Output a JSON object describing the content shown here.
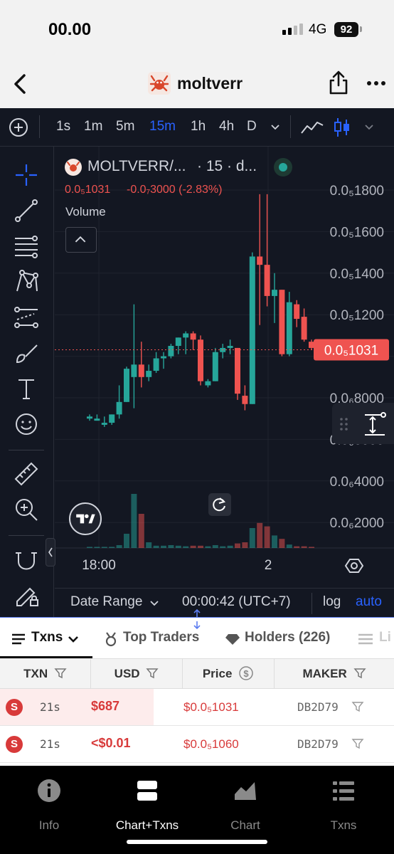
{
  "status": {
    "time": "00.00",
    "network": "4G",
    "battery": "92"
  },
  "nav": {
    "title": "moltverr"
  },
  "toolbar": {
    "timeframes": [
      "1s",
      "1m",
      "5m",
      "15m",
      "1h",
      "4h",
      "D"
    ],
    "active_timeframe": "15m"
  },
  "legend": {
    "symbol": "MOLTVERR/...",
    "interval": "· 15 · d...",
    "price": "0.0₅1031",
    "change": "-0.0₇3000 (-2.83%)",
    "volume_label": "Volume"
  },
  "chart_data": {
    "type": "candlestick",
    "x_tick_labels": [
      "18:00",
      "2"
    ],
    "y_tick_labels": [
      "0.0₅1800",
      "0.0₅1600",
      "0.0₅1400",
      "0.0₅1200",
      "0.0₅1031",
      "0.0₆8000",
      "0.0₆6000",
      "0.0₆4000",
      "0.0₆2000"
    ],
    "y_unit_note": "values in units of 1e-6",
    "ylim": [
      0.3,
      1.9
    ],
    "last_price": 1.031,
    "last_price_label": "0.0₅1031",
    "candles": [
      {
        "o": 0.7,
        "h": 0.72,
        "l": 0.69,
        "c": 0.71
      },
      {
        "o": 0.69,
        "h": 0.72,
        "l": 0.69,
        "c": 0.7
      },
      {
        "o": 0.67,
        "h": 0.71,
        "l": 0.66,
        "c": 0.68
      },
      {
        "o": 0.68,
        "h": 0.72,
        "l": 0.67,
        "c": 0.72
      },
      {
        "o": 0.72,
        "h": 0.86,
        "l": 0.7,
        "c": 0.78
      },
      {
        "o": 0.78,
        "h": 0.95,
        "l": 0.78,
        "c": 0.94
      },
      {
        "o": 0.9,
        "h": 1.25,
        "l": 0.75,
        "c": 0.96
      },
      {
        "o": 0.96,
        "h": 1.07,
        "l": 0.85,
        "c": 0.9
      },
      {
        "o": 0.9,
        "h": 0.96,
        "l": 0.88,
        "c": 0.93
      },
      {
        "o": 0.93,
        "h": 1.02,
        "l": 0.92,
        "c": 0.99
      },
      {
        "o": 0.99,
        "h": 1.02,
        "l": 0.94,
        "c": 1.0
      },
      {
        "o": 1.0,
        "h": 1.06,
        "l": 0.99,
        "c": 1.05
      },
      {
        "o": 1.05,
        "h": 1.09,
        "l": 1.01,
        "c": 1.09
      },
      {
        "o": 1.09,
        "h": 1.12,
        "l": 1.01,
        "c": 1.11
      },
      {
        "o": 1.11,
        "h": 1.12,
        "l": 1.03,
        "c": 1.08
      },
      {
        "o": 1.08,
        "h": 1.1,
        "l": 0.86,
        "c": 0.88
      },
      {
        "o": 0.86,
        "h": 0.89,
        "l": 0.85,
        "c": 0.88
      },
      {
        "o": 0.88,
        "h": 1.04,
        "l": 0.88,
        "c": 1.02
      },
      {
        "o": 1.02,
        "h": 1.06,
        "l": 0.99,
        "c": 1.04
      },
      {
        "o": 1.04,
        "h": 1.08,
        "l": 1.01,
        "c": 1.05
      },
      {
        "o": 1.04,
        "h": 1.04,
        "l": 0.79,
        "c": 0.82
      },
      {
        "o": 0.81,
        "h": 0.86,
        "l": 0.74,
        "c": 0.77
      },
      {
        "o": 0.77,
        "h": 1.5,
        "l": 0.77,
        "c": 1.48
      },
      {
        "o": 1.48,
        "h": 1.78,
        "l": 1.15,
        "c": 1.44
      },
      {
        "o": 1.44,
        "h": 1.78,
        "l": 1.24,
        "c": 1.29
      },
      {
        "o": 1.29,
        "h": 1.4,
        "l": 1.16,
        "c": 1.32
      },
      {
        "o": 1.32,
        "h": 1.32,
        "l": 1.0,
        "c": 1.01
      },
      {
        "o": 1.01,
        "h": 1.31,
        "l": 1.0,
        "c": 1.26
      },
      {
        "o": 1.25,
        "h": 1.27,
        "l": 1.14,
        "c": 1.18
      },
      {
        "o": 1.19,
        "h": 1.23,
        "l": 1.07,
        "c": 1.08
      },
      {
        "o": 1.07,
        "h": 1.08,
        "l": 1.03,
        "c": 1.04
      }
    ],
    "volume_scale": "relative",
    "volumes": [
      0.02,
      0.02,
      0.02,
      0.02,
      0.05,
      0.25,
      0.95,
      0.6,
      0.1,
      0.04,
      0.04,
      0.05,
      0.04,
      0.03,
      0.04,
      0.04,
      0.03,
      0.05,
      0.03,
      0.04,
      0.08,
      0.1,
      0.35,
      0.44,
      0.38,
      0.22,
      0.16,
      0.06,
      0.03,
      0.03,
      0.02
    ]
  },
  "bottombar": {
    "date_range": "Date Range",
    "clock": "00:00:42 (UTC+7)",
    "log": "log",
    "auto": "auto"
  },
  "tabs": [
    {
      "label": "Txns"
    },
    {
      "label": "Top Traders"
    },
    {
      "label": "Holders (226)"
    },
    {
      "label": "Li"
    }
  ],
  "table": {
    "headers": [
      "TXN",
      "USD",
      "Price",
      "MAKER"
    ],
    "rows": [
      {
        "type": "S",
        "age": "21s",
        "usd": "$687",
        "price": "$0.0₅1031",
        "maker": "DB2D79"
      },
      {
        "type": "S",
        "age": "21s",
        "usd": "<$0.01",
        "price": "$0.0₅1060",
        "maker": "DB2D79"
      }
    ]
  },
  "tabbar": [
    {
      "label": "Info"
    },
    {
      "label": "Chart+Txns"
    },
    {
      "label": "Chart"
    },
    {
      "label": "Txns"
    }
  ],
  "colors": {
    "up": "#26a69a",
    "down": "#ef5350",
    "accent": "#2962ff",
    "sell": "#d83a3a",
    "chart_bg": "#131722"
  }
}
